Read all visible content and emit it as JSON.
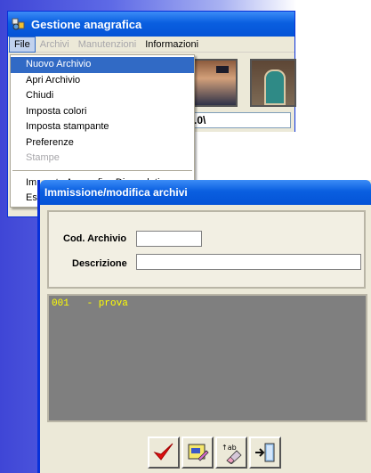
{
  "back_window": {
    "title": "Gestione anagrafica",
    "menubar": [
      "File",
      "Archivi",
      "Manutenzioni",
      "Informazioni"
    ],
    "path_text": ".0\\"
  },
  "file_menu": {
    "items": [
      {
        "label": "Nuovo Archivio",
        "state": "highlighted"
      },
      {
        "label": "Apri Archivio",
        "state": "enabled"
      },
      {
        "label": "Chiudi",
        "state": "enabled"
      },
      {
        "label": "Imposta colori",
        "state": "enabled"
      },
      {
        "label": "Imposta stampante",
        "state": "enabled"
      },
      {
        "label": "Preferenze",
        "state": "enabled"
      },
      {
        "label": "Stampe",
        "state": "disabled"
      }
    ],
    "items_after_separator": [
      {
        "label": "Im... ...to Anagrafica Diomedeti...",
        "state": "enabled"
      },
      {
        "label": "Es...",
        "state": "enabled"
      }
    ]
  },
  "dialog": {
    "title": "Immissione/modifica archivi",
    "code_label": "Cod. Archivio",
    "code_value": "",
    "description_label": "Descrizione",
    "description_value": "",
    "list_rows": [
      "001   - prova"
    ],
    "toolbar_icons": [
      "checkmark-icon",
      "edit-icon",
      "eraser-icon",
      "exit-door-icon"
    ]
  },
  "colors": {
    "title_bar": "#0453d6",
    "menu_highlight": "#316ac5",
    "list_background": "#7f7f7f",
    "list_text": "#ffff00",
    "check_red": "#e01010"
  }
}
